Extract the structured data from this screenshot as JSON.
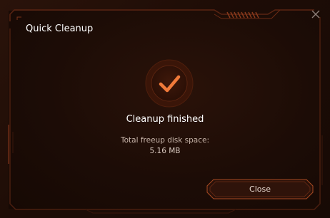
{
  "dialog": {
    "title": "Quick Cleanup",
    "close_icon": "close-x-icon"
  },
  "status": {
    "icon": "checkmark-icon",
    "heading": "Cleanup finished",
    "freeup_label": "Total freeup disk space:",
    "freeup_value": "5.16 MB"
  },
  "actions": {
    "close_label": "Close"
  },
  "colors": {
    "accent": "#e8632a",
    "frame": "#5a2412",
    "background": "#1c0c06"
  }
}
